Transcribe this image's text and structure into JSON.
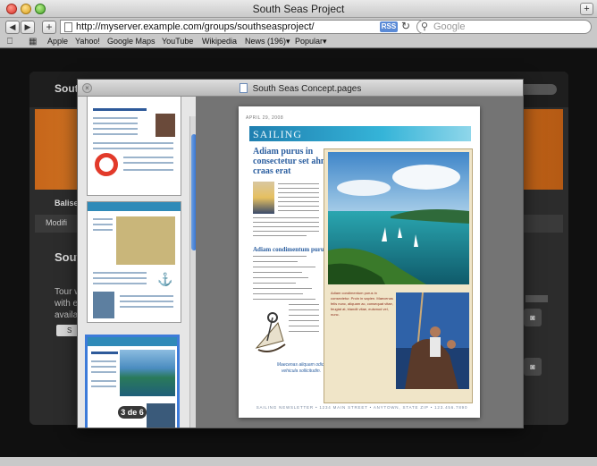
{
  "browser": {
    "title": "South Seas Project",
    "url": "http://myserver.example.com/groups/southseasproject/",
    "rss_label": "RSS",
    "search_placeholder": "Google",
    "bookmarks": [
      "Apple",
      "Yahoo!",
      "Google Maps",
      "YouTube",
      "Wikipedia",
      "News (196)▾",
      "Popular▾"
    ]
  },
  "site": {
    "title": "South",
    "nav_label": "Balise",
    "modified": "Modifi",
    "section_title": "Sout",
    "body_lines": [
      "Tour w",
      "with ex",
      "availab"
    ],
    "small_button": "S"
  },
  "quicklook": {
    "title": "South Seas Concept.pages",
    "page_badge": "3 de 6",
    "doc": {
      "date": "APRIL 29, 2008",
      "masthead": "SAILING",
      "headline": "Adiam purus in consectetur set ahmet craas erat",
      "subhead": "Adiam condimentum purus",
      "caption": "Adiam condimentum purus in consectetur. Proin in sapien. Maecenas felis nunc, aliquam ac, consequat vitae, feugiat at, blandit vitae, euismod vel, nunc.",
      "quote": "Maecenas aliquam odio, vehicula sollicitudin.",
      "footer": "SAILING NEWSLETTER • 1234 MAIN STREET • ANYTOWN, STATE ZIP • 123.456.7890"
    }
  },
  "colors": {
    "selection": "#3d7bd9",
    "headline": "#2c5fa0",
    "banner": "#d37622"
  }
}
